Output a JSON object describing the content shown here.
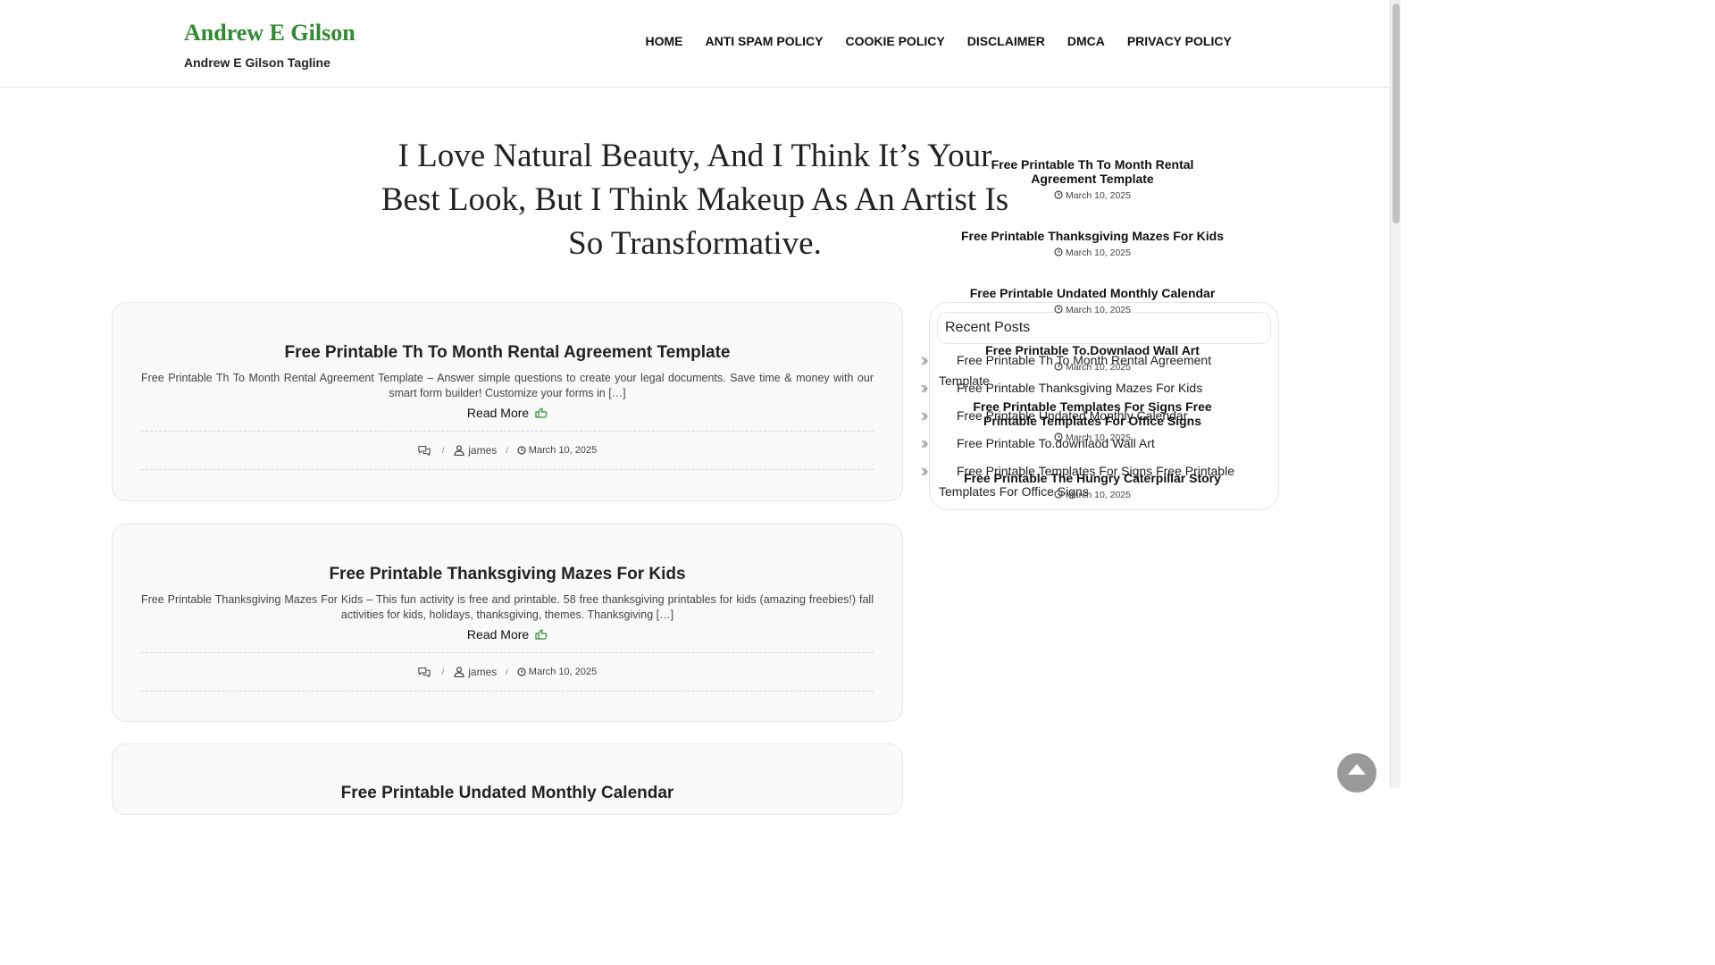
{
  "header": {
    "site_title": "Andrew E Gilson",
    "tagline": "Andrew E Gilson Tagline",
    "nav": [
      "HOME",
      "ANTI SPAM POLICY",
      "COOKIE POLICY",
      "DISCLAIMER",
      "DMCA",
      "PRIVACY POLICY"
    ]
  },
  "hero": {
    "quote": "I Love Natural Beauty, And I Think It’s Your Best Look, But I Think Makeup As An Artist Is So Transformative."
  },
  "posts": [
    {
      "title": "Free Printable Th To Month Rental Agreement Template",
      "excerpt": "Free Printable Th To Month Rental Agreement Template – Answer simple questions to create your legal documents. Save time & money with our smart form builder! Customize your forms in […]",
      "read_more": "Read More",
      "author": "james",
      "date": "March 10, 2025"
    },
    {
      "title": "Free Printable Thanksgiving Mazes For Kids",
      "excerpt": "Free Printable Thanksgiving Mazes For Kids – This fun activity is free and printable. 58 free thanksgiving printables for kids (amazing freebies!) fall activities for kids, holidays, thanksgiving, themes. Thanksgiving […]",
      "read_more": "Read More",
      "author": "james",
      "date": "March 10, 2025"
    },
    {
      "title": "Free Printable Undated Monthly Calendar"
    }
  ],
  "recent_posts": {
    "heading": "Recent Posts",
    "items": [
      "Free Printable Th To Month Rental Agreement Template",
      "Free Printable Thanksgiving Mazes For Kids",
      "Free Printable Undated Monthly Calendar",
      "Free Printable To.downlaod Wall Art",
      "Free Printable Templates For Signs Free Printable Templates For Office Signs"
    ]
  },
  "stacked_posts": [
    {
      "title": "Free Printable Th To Month Rental Agreement Template",
      "date": "March 10, 2025"
    },
    {
      "title": "Free Printable Thanksgiving Mazes For Kids",
      "date": "March 10, 2025"
    },
    {
      "title": "Free Printable Undated Monthly Calendar",
      "date": "March 10, 2025"
    },
    {
      "title": "Free Printable To.Downlaod Wall Art",
      "date": "March 10, 2025"
    },
    {
      "title": "Free Printable Templates For Signs Free Printable Templates For Office Signs",
      "date": "March 10, 2025"
    },
    {
      "title": "Free Printable The Hungry Caterpillar Story",
      "date": "March 10, 2025"
    }
  ],
  "colors": {
    "brand": "#2e8b2e",
    "text": "#222222",
    "card_bg": "#f9f9f9"
  },
  "icons": {
    "read_more": "thumbs-up-icon",
    "comments": "comments-icon",
    "author": "user-icon",
    "date": "clock-icon",
    "list_bullet": "chevron-right-icon",
    "back_to_top": "arrow-up-icon"
  }
}
